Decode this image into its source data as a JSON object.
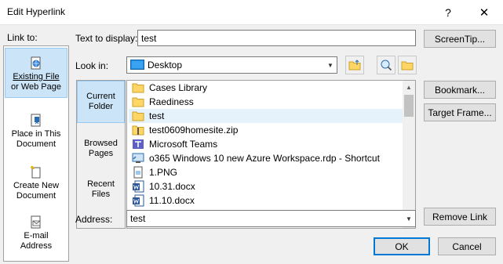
{
  "window": {
    "title": "Edit Hyperlink",
    "help_glyph": "?",
    "close_glyph": "✕"
  },
  "link_to": {
    "label": "Link to:",
    "items": [
      {
        "line1": "Existing File",
        "line2": "or Web Page",
        "icon": "globe-document-icon",
        "selected": true
      },
      {
        "line1": "Place in This",
        "line2": "Document",
        "icon": "document-bookmark-icon",
        "selected": false
      },
      {
        "line1": "Create New",
        "line2": "Document",
        "icon": "new-document-icon",
        "selected": false
      },
      {
        "line1": "E-mail",
        "line2": "Address",
        "icon": "email-icon",
        "selected": false
      }
    ]
  },
  "text_to_display": {
    "label": "Text to display:",
    "value": "test"
  },
  "look_in": {
    "label": "Look in:",
    "value": "Desktop"
  },
  "sidenav": [
    {
      "line1": "Current",
      "line2": "Folder",
      "selected": true
    },
    {
      "line1": "Browsed",
      "line2": "Pages",
      "selected": false
    },
    {
      "line1": "Recent",
      "line2": "Files",
      "selected": false
    }
  ],
  "files": [
    {
      "name": "Cases Library",
      "icon": "folder-icon",
      "selected": false
    },
    {
      "name": "Raediness",
      "icon": "folder-icon",
      "selected": false
    },
    {
      "name": "test",
      "icon": "folder-icon",
      "selected": true
    },
    {
      "name": "test0609homesite.zip",
      "icon": "zip-file-icon",
      "selected": false
    },
    {
      "name": "Microsoft Teams",
      "icon": "teams-icon",
      "selected": false
    },
    {
      "name": "o365 Windows 10 new Azure Workspace.rdp - Shortcut",
      "icon": "rdp-shortcut-icon",
      "selected": false
    },
    {
      "name": "1.PNG",
      "icon": "image-file-icon",
      "selected": false
    },
    {
      "name": "10.31.docx",
      "icon": "word-document-icon",
      "selected": false
    },
    {
      "name": "11.10.docx",
      "icon": "word-document-icon",
      "selected": false
    }
  ],
  "address": {
    "label": "Address:",
    "value": "test"
  },
  "buttons": {
    "screentip": "ScreenTip...",
    "bookmark": "Bookmark...",
    "target_frame": "Target Frame...",
    "remove_link": "Remove Link",
    "ok": "OK",
    "cancel": "Cancel"
  },
  "colors": {
    "selection": "#cce4f7",
    "selection_border": "#99c9ef",
    "folder": "#ffd666",
    "accent": "#0078d7"
  }
}
